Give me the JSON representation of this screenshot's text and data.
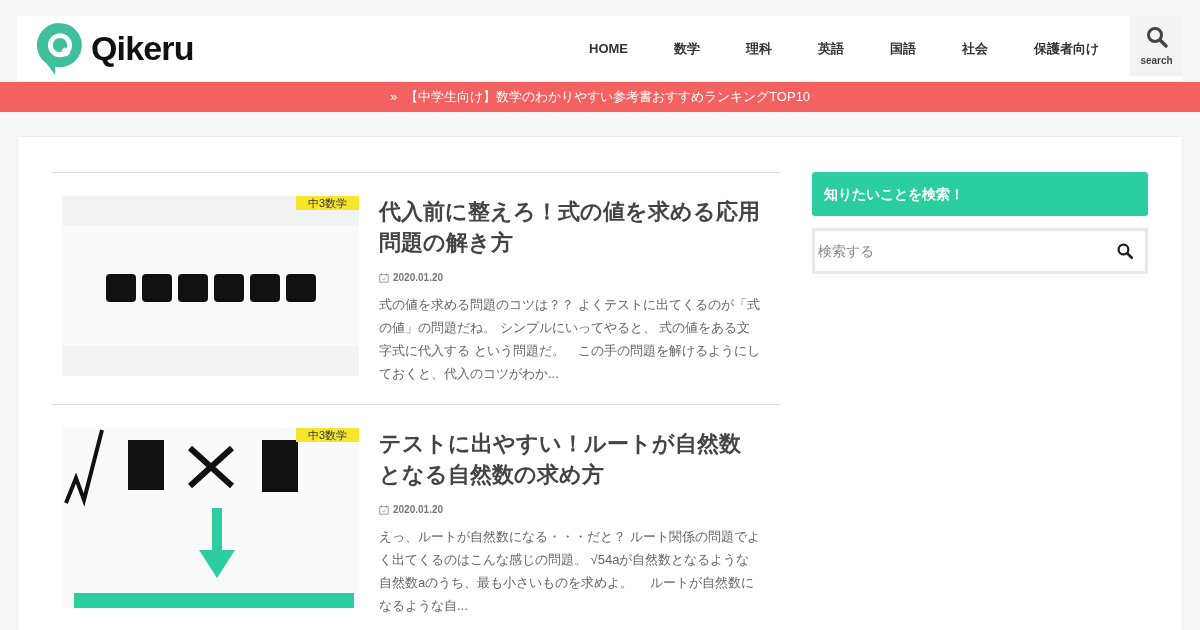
{
  "header": {
    "logo_text": "Qikeru",
    "nav": [
      {
        "label": "HOME"
      },
      {
        "label": "数学"
      },
      {
        "label": "理科"
      },
      {
        "label": "英語"
      },
      {
        "label": "国語"
      },
      {
        "label": "社会"
      },
      {
        "label": "保護者向け"
      }
    ],
    "search_label": "search"
  },
  "notice_bar": {
    "arrow": "»",
    "text": "【中学生向け】数学のわかりやすい参考書おすすめランキングTOP10"
  },
  "posts": [
    {
      "tag": "中3数学",
      "title": "代入前に整えろ！式の値を求める応用問題の解き方",
      "date": "2020.01.20",
      "excerpt": "式の値を求める問題のコツは？？ よくテストに出てくるのが「式の値」の問題だね。 シンプルにいってやると、 式の値をある文字式に代入する という問題だ。　この手の問題を解けるようにしておくと、代入のコツがわか..."
    },
    {
      "tag": "中3数学",
      "title": "テストに出やすい！ルートが自然数となる自然数の求め方",
      "date": "2020.01.20",
      "excerpt": "えっ、ルートが自然数になる・・・だと？ ルート関係の問題でよく出てくるのはこんな感じの問題。 √54aが自然数となるような自然数aのうち、最も小さいものを求めよ。　 ルートが自然数になるような自..."
    }
  ],
  "sidebar": {
    "heading": "知りたいことを検索！",
    "search": {
      "placeholder": "検索する"
    }
  }
}
